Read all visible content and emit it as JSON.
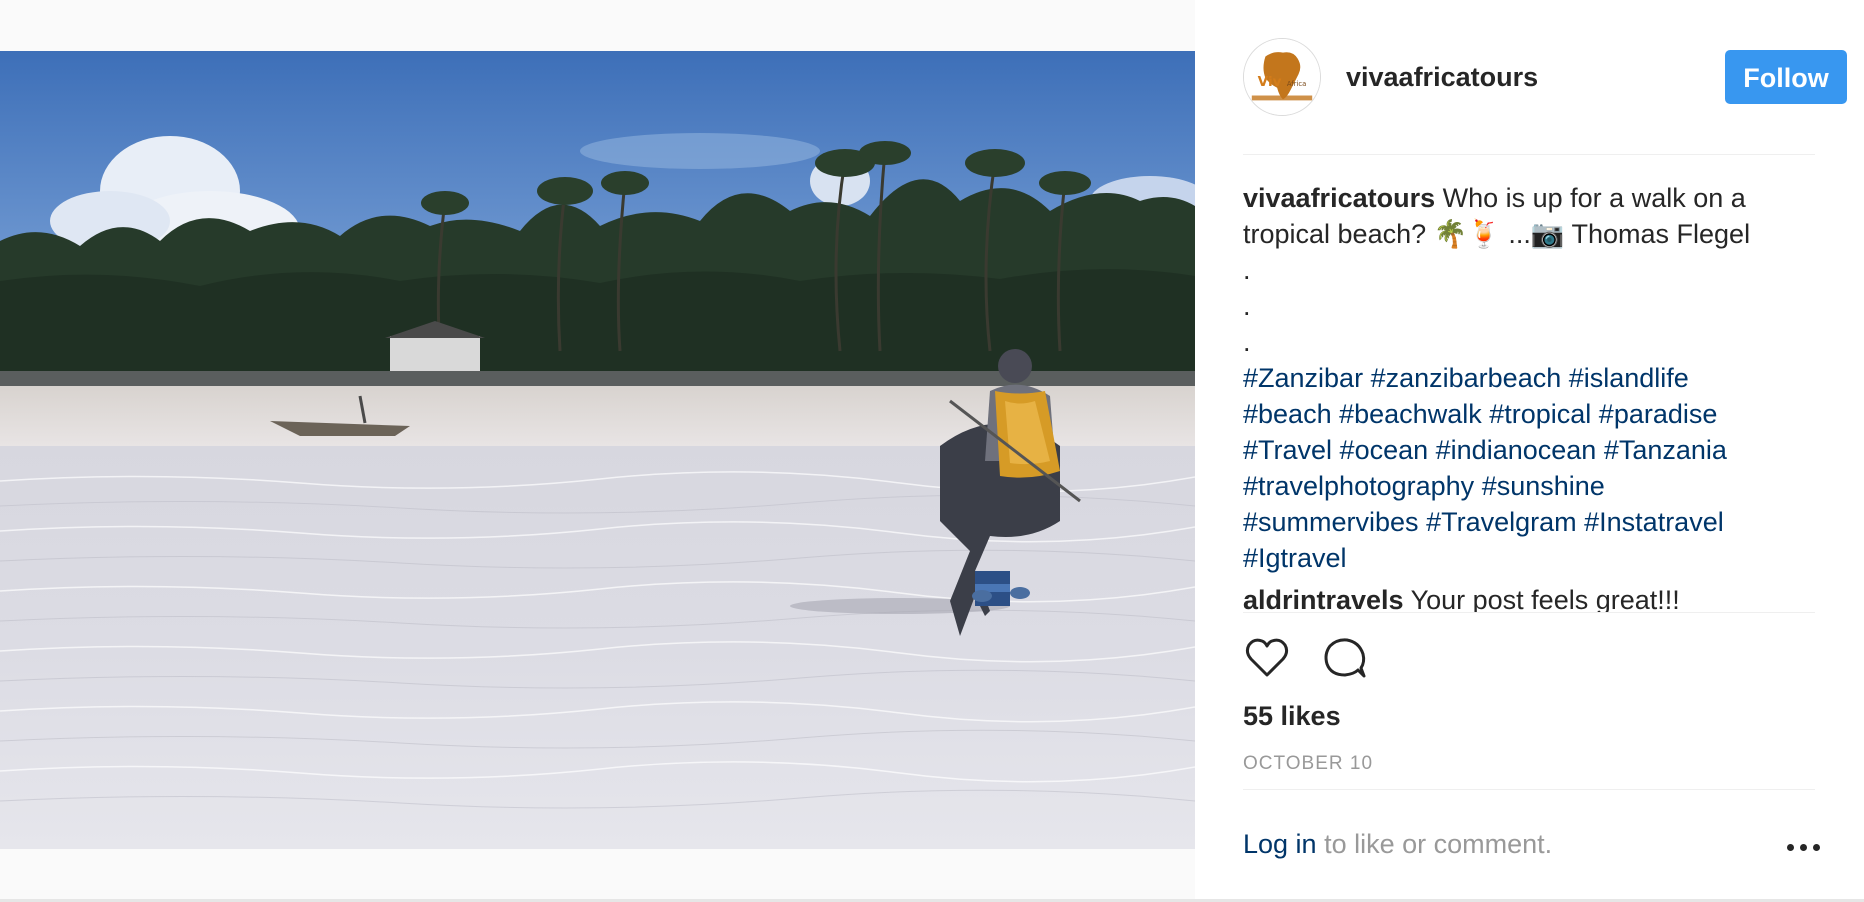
{
  "post": {
    "image_alt": "Person walking through shallow water on a tropical beach with palm trees"
  },
  "header": {
    "username": "vivaafricatours",
    "follow_label": "Follow",
    "avatar_text": "Viva Africa Tours"
  },
  "caption": {
    "username": "vivaafricatours",
    "text": " Who is up for a walk on a tropical beach? 🌴🍹 ...📷 Thomas Flegel",
    "dots": [
      ".",
      ".",
      "."
    ],
    "hashtags": [
      "#Zanzibar",
      "#zanzibarbeach",
      "#islandlife",
      "#beach",
      "#beachwalk",
      "#tropical",
      "#paradise",
      "#Travel",
      "#ocean",
      "#indianocean",
      "#Tanzania",
      "#travelphotography",
      "#sunshine",
      "#summervibes",
      "#Travelgram",
      "#Instatravel",
      "#Igtravel"
    ]
  },
  "comments": [
    {
      "username": "aldrintravels",
      "text": " Your post feels great!!!"
    }
  ],
  "likes_label": "55 likes",
  "date_label": "OCTOBER 10",
  "login": {
    "link_label": "Log in",
    "rest_label": " to like or comment."
  },
  "icons": {
    "like": "heart-icon",
    "comment": "comment-bubble-icon",
    "more": "more-options-icon"
  },
  "colors": {
    "follow_button": "#3897f0",
    "hashtag": "#003569",
    "text": "#262626",
    "muted": "#999999"
  }
}
